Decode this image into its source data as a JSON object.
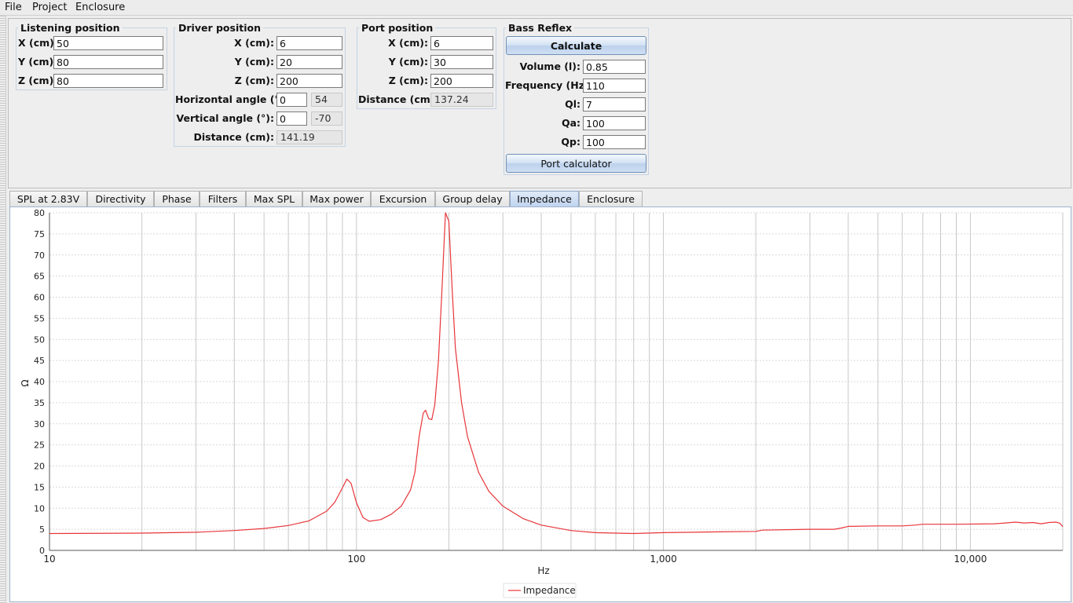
{
  "menu": [
    "File",
    "Project",
    "Enclosure"
  ],
  "listening": {
    "title": "Listening position",
    "x_label": "X (cm):",
    "x": "50",
    "y_label": "Y (cm):",
    "y": "80",
    "z_label": "Z (cm):",
    "z": "80"
  },
  "driver": {
    "title": "Driver position",
    "x_label": "X (cm):",
    "x": "6",
    "y_label": "Y (cm):",
    "y": "20",
    "z_label": "Z (cm):",
    "z": "200",
    "h_angle_label": "Horizontal angle (°):",
    "h_angle": "0",
    "h_angle_computed": "54",
    "v_angle_label": "Vertical angle (°):",
    "v_angle": "0",
    "v_angle_computed": "-70",
    "distance_label": "Distance (cm):",
    "distance": "141.19"
  },
  "port": {
    "title": "Port position",
    "x_label": "X (cm):",
    "x": "6",
    "y_label": "Y (cm):",
    "y": "30",
    "z_label": "Z (cm):",
    "z": "200",
    "distance_label": "Distance (cm):",
    "distance": "137.24"
  },
  "bass_reflex": {
    "title": "Bass Reflex",
    "calculate_label": "Calculate",
    "volume_label": "Volume (l):",
    "volume": "0.85",
    "frequency_label": "Frequency (Hz):",
    "frequency": "110",
    "ql_label": "Ql:",
    "ql": "7",
    "qa_label": "Qa:",
    "qa": "100",
    "qp_label": "Qp:",
    "qp": "100",
    "port_calc_label": "Port calculator"
  },
  "tabs": [
    "SPL at 2.83V",
    "Directivity",
    "Phase",
    "Filters",
    "Max SPL",
    "Max power",
    "Excursion",
    "Group delay",
    "Impedance",
    "Enclosure"
  ],
  "active_tab": "Impedance",
  "colors": {
    "series": "#e8353a",
    "active_tab": "#c9daf1",
    "grid": "#c8c8c8"
  },
  "chart_data": {
    "type": "line",
    "xlabel": "Hz",
    "ylabel": "Ω",
    "x_scale": "log",
    "xlim": [
      10,
      20000
    ],
    "ylim": [
      0,
      80
    ],
    "x_ticks": [
      10,
      100,
      1000,
      10000
    ],
    "x_tick_labels": [
      "10",
      "100",
      "1,000",
      "10,000"
    ],
    "y_ticks": [
      0,
      5,
      10,
      15,
      20,
      25,
      30,
      35,
      40,
      45,
      50,
      55,
      60,
      65,
      70,
      75,
      80
    ],
    "y_tick_labels": [
      "0",
      "5",
      "10",
      "15",
      "20",
      "25",
      "30",
      "35",
      "40",
      "45",
      "50",
      "55",
      "60",
      "65",
      "70",
      "75",
      "80"
    ],
    "grid": true,
    "legend_position": "bottom",
    "series": [
      {
        "name": "Impedance",
        "points": [
          [
            10,
            4.0
          ],
          [
            20,
            4.1
          ],
          [
            30,
            4.3
          ],
          [
            40,
            4.7
          ],
          [
            50,
            5.2
          ],
          [
            60,
            5.9
          ],
          [
            70,
            7.0
          ],
          [
            80,
            9.3
          ],
          [
            85,
            11.4
          ],
          [
            90,
            14.8
          ],
          [
            93,
            16.9
          ],
          [
            96,
            15.9
          ],
          [
            100,
            11.3
          ],
          [
            105,
            7.8
          ],
          [
            110,
            6.9
          ],
          [
            120,
            7.3
          ],
          [
            130,
            8.6
          ],
          [
            140,
            10.5
          ],
          [
            150,
            14.3
          ],
          [
            155,
            18.5
          ],
          [
            160,
            27.0
          ],
          [
            165,
            32.5
          ],
          [
            168,
            33.2
          ],
          [
            172,
            31.2
          ],
          [
            176,
            31.0
          ],
          [
            180,
            34.5
          ],
          [
            185,
            45.0
          ],
          [
            190,
            62.0
          ],
          [
            195,
            80.0
          ],
          [
            200,
            78.0
          ],
          [
            205,
            62.0
          ],
          [
            210,
            48.0
          ],
          [
            220,
            35.0
          ],
          [
            230,
            27.0
          ],
          [
            250,
            18.5
          ],
          [
            270,
            14.0
          ],
          [
            300,
            10.5
          ],
          [
            350,
            7.5
          ],
          [
            400,
            6.0
          ],
          [
            500,
            4.7
          ],
          [
            600,
            4.2
          ],
          [
            800,
            4.0
          ],
          [
            1000,
            4.2
          ],
          [
            1500,
            4.4
          ],
          [
            2000,
            4.5
          ],
          [
            2100,
            4.8
          ],
          [
            3000,
            5.0
          ],
          [
            3600,
            5.0
          ],
          [
            3800,
            5.3
          ],
          [
            4000,
            5.7
          ],
          [
            5000,
            5.8
          ],
          [
            6000,
            5.8
          ],
          [
            6600,
            6.0
          ],
          [
            7000,
            6.2
          ],
          [
            9000,
            6.2
          ],
          [
            12000,
            6.3
          ],
          [
            13000,
            6.5
          ],
          [
            14000,
            6.7
          ],
          [
            15000,
            6.5
          ],
          [
            16000,
            6.6
          ],
          [
            17000,
            6.3
          ],
          [
            18000,
            6.6
          ],
          [
            19000,
            6.7
          ],
          [
            19600,
            6.4
          ],
          [
            20000,
            5.6
          ]
        ]
      }
    ]
  }
}
